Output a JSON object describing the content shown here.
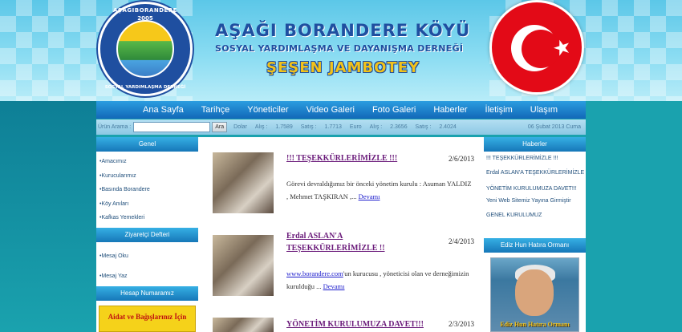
{
  "header": {
    "logo_top": "AŞAĞIBORANDERE",
    "logo_year": "2005",
    "logo_bottom": "SOSYAL YARDIMLAŞMA DERNEĞİ",
    "title": "AŞAĞI BORANDERE KÖYÜ",
    "subtitle": "SOSYAL YARDIMLAŞMA VE DAYANIŞMA DERNEĞİ",
    "name": "ŞEŞEN JAMBOTEY"
  },
  "nav": [
    "Ana Sayfa",
    "Tarihçe",
    "Yöneticiler",
    "Video Galeri",
    "Foto Galeri",
    "Haberler",
    "İletişim",
    "Ulaşım"
  ],
  "search": {
    "label": "Ürün Arama :",
    "button": "Ara",
    "dollar_label": "Dolar",
    "alis_label": "Alış :",
    "dollar_alis": "1.7589",
    "satis_label": "Satış :",
    "dollar_satis": "1.7713",
    "euro_label": "Euro",
    "euro_alis": "2.3656",
    "euro_satis": "2.4024",
    "date": "06 Şubat 2013 Cuma"
  },
  "left": {
    "genel_title": "Genel",
    "genel_items": [
      "Amacımız",
      "Kurucularımız",
      "Basında Borandere",
      "Köy Anıları",
      "Kafkas Yemekleri"
    ],
    "ziyaretci_title": "Ziyaretçi Defteri",
    "ziyaretci_items": [
      "Mesaj Oku",
      "Mesaj Yaz"
    ],
    "hesap_title": "Hesap Numaramız",
    "bank_text": "Aidat ve Bağışlarınız İçin"
  },
  "articles": [
    {
      "title": "!!! TEŞEKKÜRLERİMİZLE !!!",
      "date": "2/6/2013",
      "body": "Görevi devraldığımız bir önceki yönetim kurulu : Asuman YALDIZ , Mehmet TAŞKIRAN ,...",
      "more": "Devamı"
    },
    {
      "title": "Erdal ASLAN'A TEŞEKKÜRLERİMİZLE !!",
      "date": "2/4/2013",
      "link": "www.borandere.com",
      "body": "'un kurucusu , yöneticisi olan ve derneğimizin kurulduğu ...",
      "more": "Devamı"
    },
    {
      "title": "YÖNETİM KURULUMUZA DAVET!!!",
      "date": "2/3/2013"
    }
  ],
  "right": {
    "haberler_title": "Haberler",
    "haberler_items": [
      "!!! TEŞEKKÜRLERİMİZLE !!!",
      "Erdal ASLAN'A TEŞEKKÜRLERİMİZLE !!",
      "YÖNETİM KURULUMUZA DAVET!!!",
      "Yeni Web Sitemiz Yayına Girmiştir",
      "GENEL KURULUMUZ"
    ],
    "ormani_title": "Ediz Hun Hatıra Ormanı",
    "ormani_caption": "Ediz Hun Hatıra Ormanı"
  }
}
